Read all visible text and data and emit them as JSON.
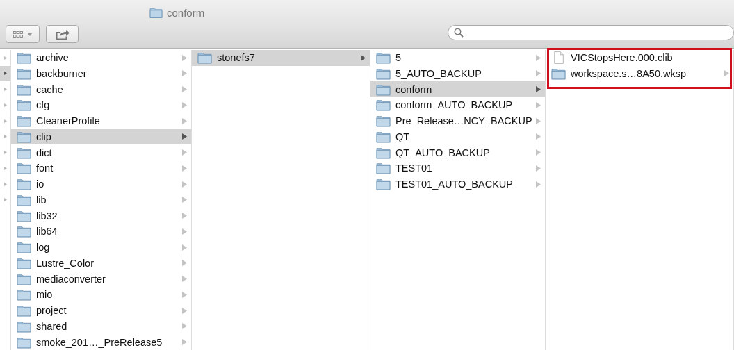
{
  "window": {
    "title": "conform"
  },
  "partial_column": {
    "rows": [
      {
        "selected": false
      },
      {
        "selected": true
      },
      {
        "selected": false
      },
      {
        "selected": false
      },
      {
        "selected": false
      },
      {
        "selected": false
      },
      {
        "selected": false
      },
      {
        "selected": false
      },
      {
        "selected": false
      },
      {
        "selected": false
      }
    ]
  },
  "columns": [
    {
      "items": [
        {
          "name": "archive",
          "kind": "folder",
          "selected": false
        },
        {
          "name": "backburner",
          "kind": "folder",
          "selected": false
        },
        {
          "name": "cache",
          "kind": "folder",
          "selected": false
        },
        {
          "name": "cfg",
          "kind": "folder",
          "selected": false
        },
        {
          "name": "CleanerProfile",
          "kind": "folder",
          "selected": false
        },
        {
          "name": "clip",
          "kind": "folder",
          "selected": true
        },
        {
          "name": "dict",
          "kind": "folder",
          "selected": false
        },
        {
          "name": "font",
          "kind": "folder",
          "selected": false
        },
        {
          "name": "io",
          "kind": "folder",
          "selected": false
        },
        {
          "name": "lib",
          "kind": "folder",
          "selected": false
        },
        {
          "name": "lib32",
          "kind": "folder",
          "selected": false
        },
        {
          "name": "lib64",
          "kind": "folder",
          "selected": false
        },
        {
          "name": "log",
          "kind": "folder",
          "selected": false
        },
        {
          "name": "Lustre_Color",
          "kind": "folder",
          "selected": false
        },
        {
          "name": "mediaconverter",
          "kind": "folder",
          "selected": false
        },
        {
          "name": "mio",
          "kind": "folder",
          "selected": false
        },
        {
          "name": "project",
          "kind": "folder",
          "selected": false
        },
        {
          "name": "shared",
          "kind": "folder",
          "selected": false
        },
        {
          "name": "smoke_201…_PreRelease5",
          "kind": "folder",
          "selected": false
        }
      ]
    },
    {
      "items": [
        {
          "name": "stonefs7",
          "kind": "folder",
          "selected": true
        }
      ]
    },
    {
      "items": [
        {
          "name": "5",
          "kind": "folder",
          "selected": false
        },
        {
          "name": "5_AUTO_BACKUP",
          "kind": "folder",
          "selected": false
        },
        {
          "name": "conform",
          "kind": "folder",
          "selected": true
        },
        {
          "name": "conform_AUTO_BACKUP",
          "kind": "folder",
          "selected": false
        },
        {
          "name": "Pre_Release…NCY_BACKUP",
          "kind": "folder",
          "selected": false
        },
        {
          "name": "QT",
          "kind": "folder",
          "selected": false
        },
        {
          "name": "QT_AUTO_BACKUP",
          "kind": "folder",
          "selected": false
        },
        {
          "name": "TEST01",
          "kind": "folder",
          "selected": false
        },
        {
          "name": "TEST01_AUTO_BACKUP",
          "kind": "folder",
          "selected": false
        }
      ]
    },
    {
      "highlight_frame": true,
      "items": [
        {
          "name": "VICStopsHere.000.clib",
          "kind": "file",
          "selected": false
        },
        {
          "name": "workspace.s…8A50.wksp",
          "kind": "folder",
          "selected": false
        }
      ]
    }
  ]
}
